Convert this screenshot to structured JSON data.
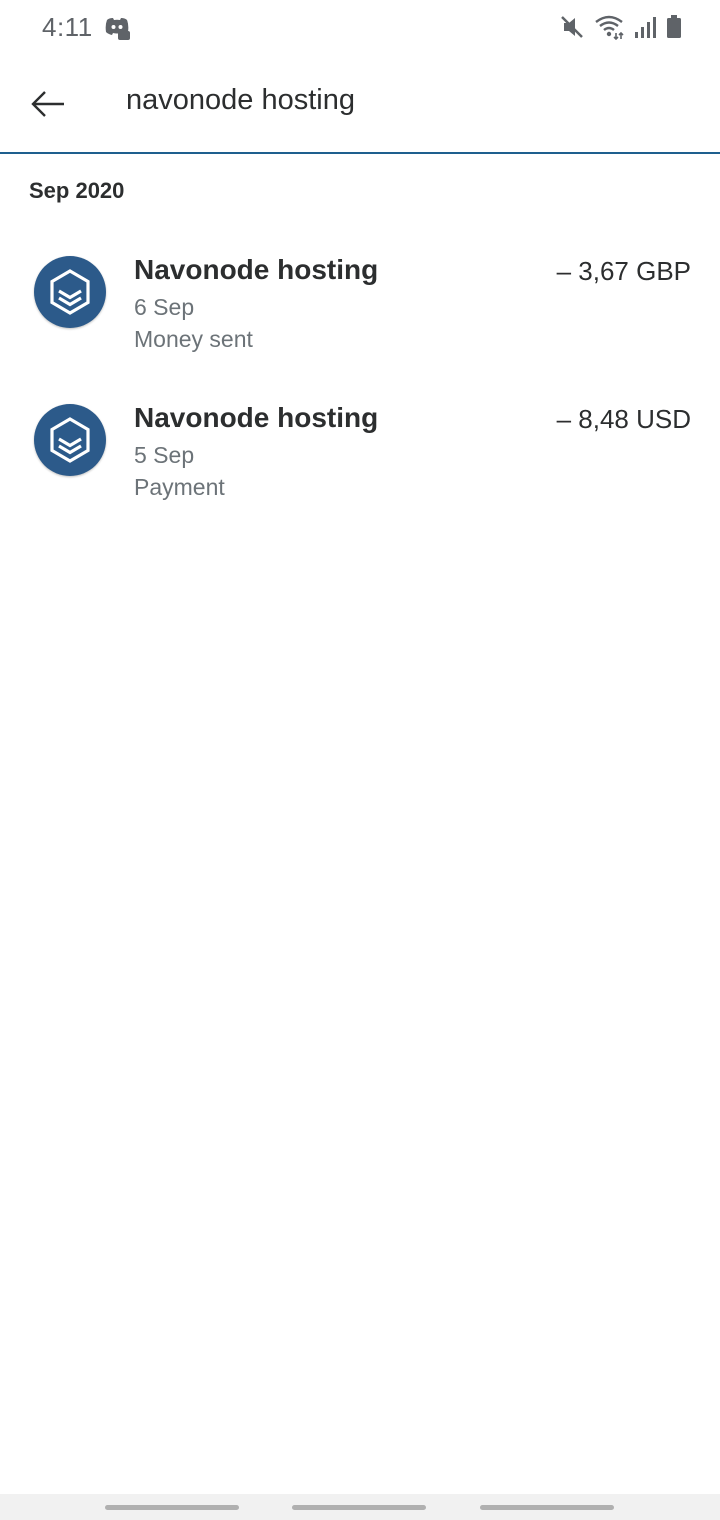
{
  "status_bar": {
    "time": "4:11",
    "icons": [
      "discord-icon",
      "mute-icon",
      "wifi-icon",
      "signal-icon",
      "battery-icon"
    ]
  },
  "search": {
    "query": "navonode hosting"
  },
  "section": {
    "label": "Sep 2020"
  },
  "transactions": [
    {
      "name": "Navonode hosting",
      "date": "6 Sep",
      "type": "Money sent",
      "amount": "– 3,67 GBP"
    },
    {
      "name": "Navonode hosting",
      "date": "5 Sep",
      "type": "Payment",
      "amount": "– 8,48 USD"
    }
  ],
  "colors": {
    "accent": "#1e5f8e",
    "avatar_bg": "#2c5a8a",
    "text_primary": "#2c2e2f",
    "text_secondary": "#6c7378"
  }
}
